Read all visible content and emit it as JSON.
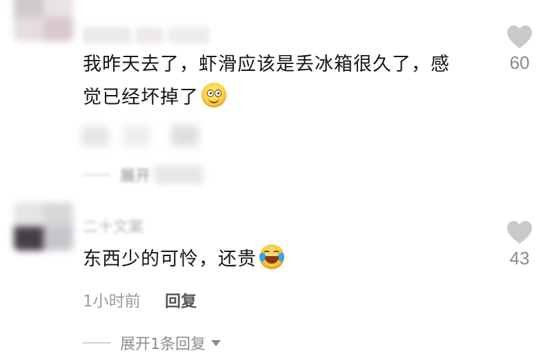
{
  "comments": [
    {
      "text_line1": "我昨天去了，虾滑应该是丢冰箱很久了，感",
      "text_line2": "觉已经坏掉了",
      "emoji": "smiling-face-emoji",
      "likes": "60"
    },
    {
      "username_blurred": "二十文案",
      "text": "东西少的可怜，还贵",
      "emoji": "rolling-laugh-emoji",
      "time": "1小时前",
      "reply_label": "回复",
      "likes": "43",
      "expand_label": "展开1条回复"
    }
  ],
  "blurred_expand_label": "展开",
  "icons": {
    "like": "heart-icon",
    "expand": "caret-down-icon"
  },
  "colors": {
    "heart": "#c9c9c9",
    "count": "#8a8a8a",
    "meta": "#9a9a9a"
  }
}
